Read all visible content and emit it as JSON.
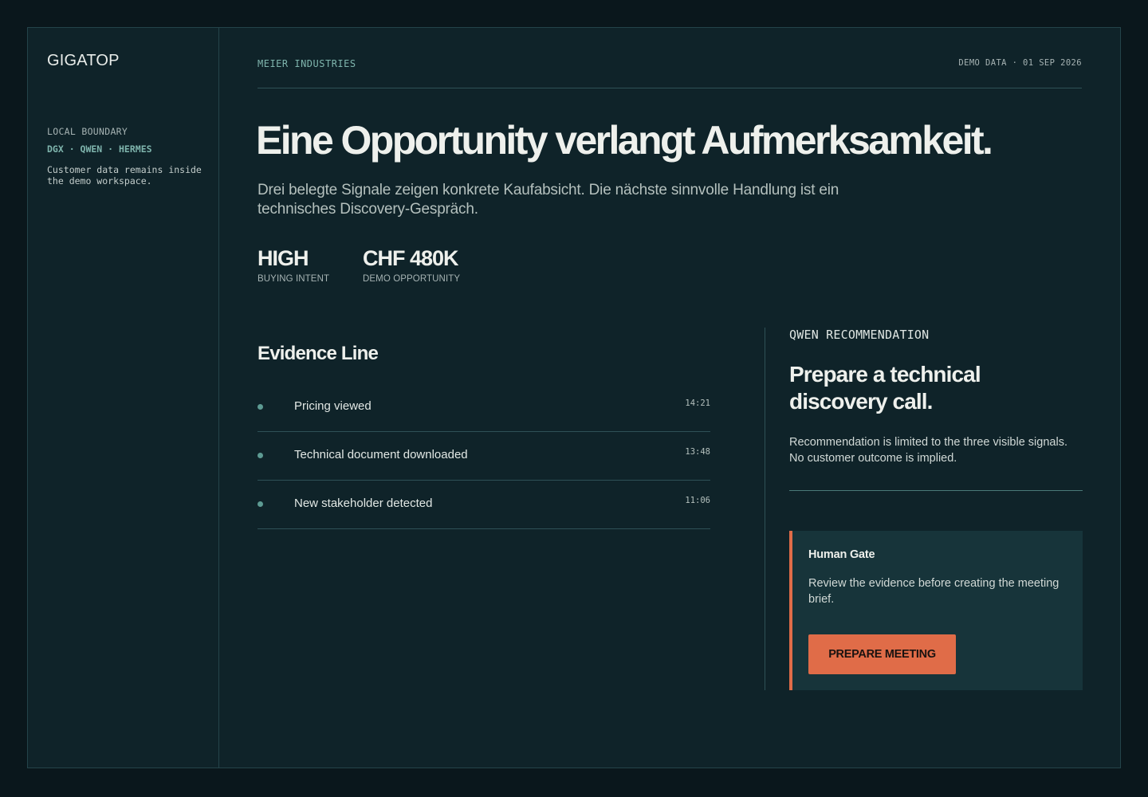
{
  "sidebar": {
    "brand": "GIGATOP",
    "boundary_title": "LOCAL BOUNDARY",
    "boundary_stack": "DGX · QWEN · HERMES",
    "boundary_note": "Customer data remains inside the demo workspace."
  },
  "header": {
    "company": "MEIER INDUSTRIES",
    "meta": "DEMO DATA · 01 SEP 2026"
  },
  "hero": {
    "headline": "Eine Opportunity verlangt Aufmerksamkeit.",
    "subline": "Drei belegte Signale zeigen konkrete Kaufabsicht. Die nächste sinnvolle Handlung ist ein technisches Discovery-Gespräch."
  },
  "stats": [
    {
      "value": "HIGH",
      "label": "BUYING INTENT"
    },
    {
      "value": "CHF 480K",
      "label": "DEMO OPPORTUNITY"
    }
  ],
  "evidence": {
    "title": "Evidence Line",
    "items": [
      {
        "label": "Pricing viewed",
        "time": "14:21"
      },
      {
        "label": "Technical document downloaded",
        "time": "13:48"
      },
      {
        "label": "New stakeholder detected",
        "time": "11:06"
      }
    ]
  },
  "recommendation": {
    "kicker": "QWEN RECOMMENDATION",
    "title": "Prepare a technical discovery call.",
    "body": "Recommendation is limited to the three visible signals. No customer outcome is implied.",
    "gate": {
      "title": "Human Gate",
      "body": "Review the evidence before creating the meeting brief.",
      "button_label": "PREPARE MEETING"
    }
  },
  "colors": {
    "background": "#0a171c",
    "panel": "#0f2329",
    "accent": "#e06c48",
    "teal": "#7fb5ad"
  }
}
